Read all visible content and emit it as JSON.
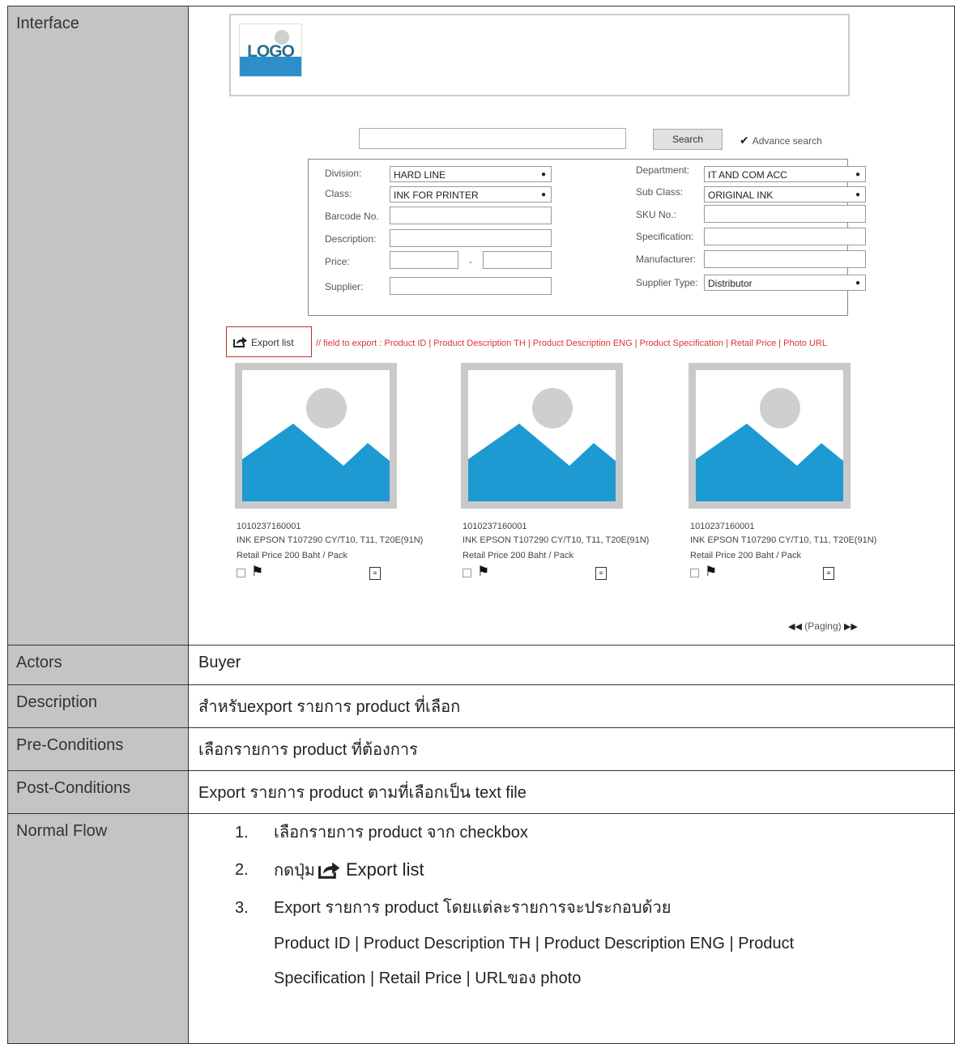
{
  "labels": {
    "interface": "Interface",
    "actors": "Actors",
    "description": "Description",
    "pre_conditions": "Pre-Conditions",
    "post_conditions": "Post-Conditions",
    "normal_flow": "Normal Flow"
  },
  "values": {
    "actors": "Buyer",
    "description": "สำหรับexport รายการ product ที่เลือก",
    "pre_conditions": "เลือกรายการ product ที่ต้องการ",
    "post_conditions": "Export รายการ product ตามที่เลือกเป็น text file"
  },
  "mockup": {
    "logo_text": "LOGO",
    "search_button": "Search",
    "advance_search": "Advance search",
    "filters": {
      "division_label": "Division:",
      "division_value": "HARD LINE",
      "department_label": "Department:",
      "department_value": "IT AND COM ACC",
      "class_label": "Class:",
      "class_value": "INK FOR PRINTER",
      "subclass_label": "Sub Class:",
      "subclass_value": "ORIGINAL INK",
      "barcode_label": "Barcode No.",
      "sku_label": "SKU No.:",
      "description_label": "Description:",
      "specification_label": "Specification:",
      "price_label": "Price:",
      "price_sep": "-",
      "manufacturer_label": "Manufacturer:",
      "supplier_label": "Supplier:",
      "supplier_type_label": "Supplier Type:",
      "supplier_type_value": "Distributor"
    },
    "export_button": "Export list",
    "export_note": "// field to export : Product ID | Product Description TH | Product Description ENG | Product Specification | Retail Price | Photo URL",
    "products": [
      {
        "id": "1010237160001",
        "desc": "INK EPSON T107290 CY/T10, T11, T20E(91N)",
        "price": "Retail Price 200 Baht / Pack"
      },
      {
        "id": "1010237160001",
        "desc": "INK EPSON T107290 CY/T10, T11, T20E(91N)",
        "price": "Retail Price 200 Baht / Pack"
      },
      {
        "id": "1010237160001",
        "desc": "INK EPSON T107290 CY/T10, T11, T20E(91N)",
        "price": "Retail Price 200 Baht / Pack"
      }
    ],
    "paging": "(Paging)"
  },
  "flow": {
    "step1_num": "1.",
    "step1": "เลือกรายการ product จาก checkbox",
    "step2_num": "2.",
    "step2": "กดปุ่ม",
    "step2_button": "Export list",
    "step3_num": "3.",
    "step3": "Export รายการ product โดยแต่ละรายการจะประกอบด้วย",
    "step3_line2": "Product ID | Product Description TH | Product Description ENG | Product",
    "step3_line3": "Specification | Retail Price | URLของ photo"
  },
  "colors": {
    "label_bg": "#c4c4c4",
    "export_note": "#dd3333",
    "photo_blue": "#1e9ad2"
  }
}
